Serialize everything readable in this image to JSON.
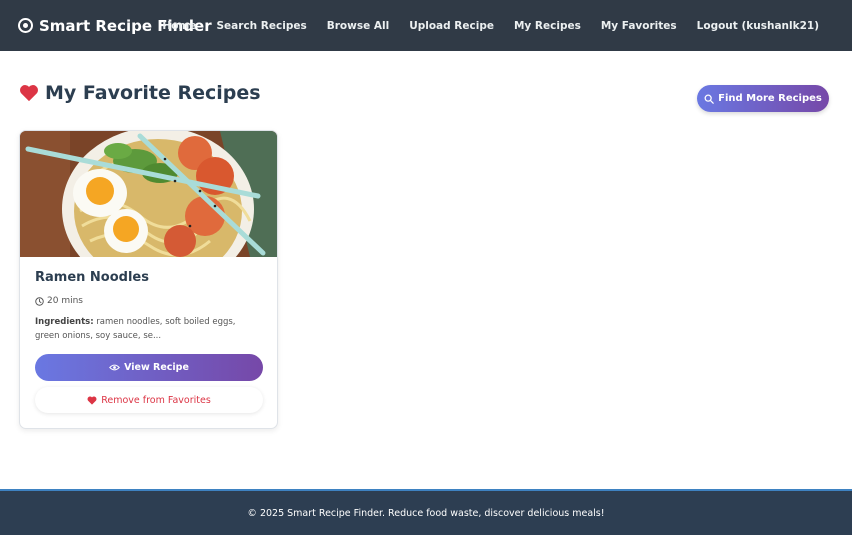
{
  "nav": {
    "brand": "Smart Recipe Finder",
    "links": [
      "Home",
      "Search Recipes",
      "Browse All",
      "Upload Recipe",
      "My Recipes",
      "My Favorites",
      "Logout (kushanlk21)"
    ]
  },
  "page": {
    "title": "My Favorite Recipes",
    "find_more_label": "Find More Recipes"
  },
  "recipe": {
    "title": "Ramen Noodles",
    "time": "20 mins",
    "ingredients_label": "Ingredients:",
    "ingredients": "ramen noodles, soft boiled eggs, green onions, soy sauce, se...",
    "view_label": "View Recipe",
    "remove_label": "Remove from Favorites"
  },
  "footer": {
    "text": "© 2025 Smart Recipe Finder. Reduce food waste, discover delicious meals!"
  },
  "colors": {
    "navbar": "#303a46",
    "accent_start": "#6a78e2",
    "accent_end": "#7648a8",
    "heart": "#dc3545",
    "footer": "#2d3e52"
  },
  "icons": [
    "brand-icon",
    "heart-icon",
    "search-icon",
    "clock-icon",
    "eye-icon"
  ]
}
